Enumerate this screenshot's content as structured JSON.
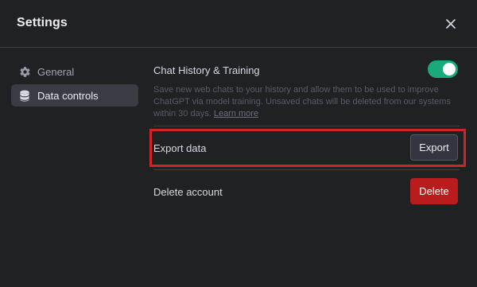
{
  "dialog": {
    "title": "Settings",
    "close_icon": "close-icon"
  },
  "sidebar": {
    "items": [
      {
        "label": "General",
        "icon": "gear-icon",
        "active": false
      },
      {
        "label": "Data controls",
        "icon": "database-icon",
        "active": true
      }
    ]
  },
  "data_controls": {
    "chat_history": {
      "label": "Chat History & Training",
      "enabled": true,
      "description": "Save new web chats to your history and allow them to be used to improve ChatGPT via model training. Unsaved chats will be deleted from our systems within 30 days.",
      "learn_more_label": "Learn more"
    },
    "export": {
      "label": "Export data",
      "button_label": "Export"
    },
    "delete": {
      "label": "Delete account",
      "button_label": "Delete"
    }
  },
  "colors": {
    "background": "#202123",
    "toggle_on": "#19a97b",
    "delete_button": "#b91c1c",
    "highlight_box": "#d2232a"
  }
}
